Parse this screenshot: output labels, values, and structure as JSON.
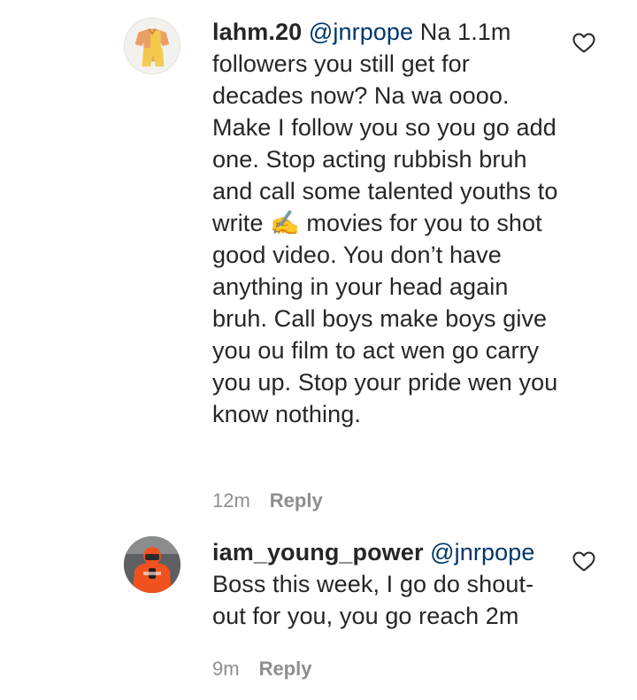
{
  "comments": [
    {
      "username": "lahm.20",
      "mention": "@jnrpope",
      "text": "Na 1.1m followers you still get for decades now? Na wa oooo. Make I follow you so you go add one. Stop acting rubbish bruh and call some talented youths to write ✍️ movies for you to shot good video. You don’t have anything in your head again bruh. Call boys make boys give you ou film to act wen go carry you up. Stop your pride wen you know nothing.",
      "time": "12m",
      "reply_label": "Reply",
      "like_icon": "heart-outline-icon"
    },
    {
      "username": "iam_young_power",
      "mention": "@jnrpope",
      "text": "Boss this week, I go do shout-out for you, you go reach 2m",
      "time": "9m",
      "reply_label": "Reply",
      "like_icon": "heart-outline-icon"
    }
  ],
  "colors": {
    "text": "#262626",
    "mention": "#00376b",
    "meta": "#8e8e8e"
  }
}
